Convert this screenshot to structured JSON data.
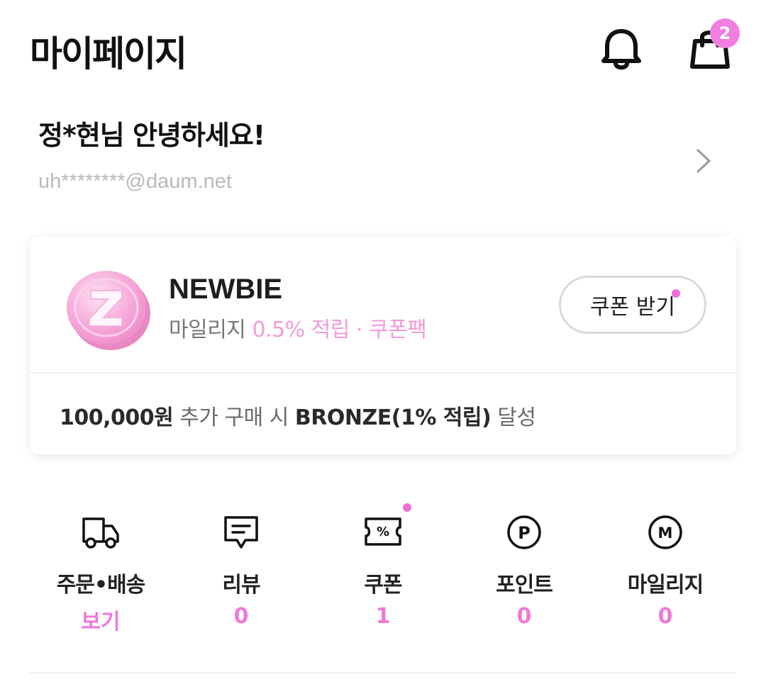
{
  "header": {
    "title": "마이페이지",
    "cart_count": "2",
    "icons": [
      "bell-icon",
      "shopping-bag-icon"
    ]
  },
  "profile": {
    "greeting": "정*현님 안녕하세요!",
    "email": "uh********@daum.net"
  },
  "grade": {
    "name": "NEWBIE",
    "benefit_prefix": "마일리지",
    "benefit_highlight": "0.5% 적립 · 쿠폰팩",
    "coupon_button": "쿠폰 받기",
    "next_amount": "100,000원",
    "next_text1": "추가 구매 시",
    "next_grade": "BRONZE(1% 적립)",
    "next_text2": "달성"
  },
  "menu": {
    "items": [
      {
        "label": "주문•배송",
        "value": "보기",
        "icon": "truck-icon"
      },
      {
        "label": "리뷰",
        "value": "0",
        "icon": "review-icon"
      },
      {
        "label": "쿠폰",
        "value": "1",
        "icon": "coupon-icon"
      },
      {
        "label": "포인트",
        "value": "0",
        "icon": "point-icon"
      },
      {
        "label": "마일리지",
        "value": "0",
        "icon": "mileage-icon"
      }
    ]
  },
  "colors": {
    "accent": "#ef79d9",
    "text": "#1a1a1a",
    "muted": "#b7b9bd"
  }
}
